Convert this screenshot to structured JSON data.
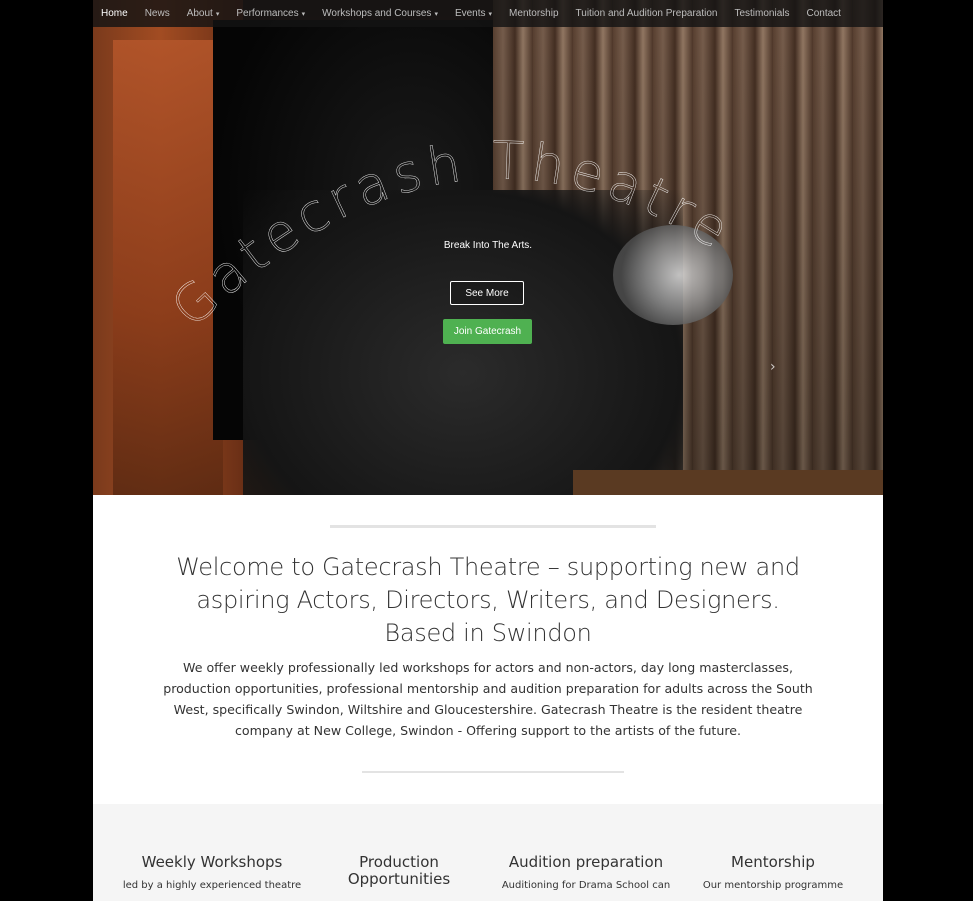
{
  "nav": {
    "items": [
      {
        "label": "Home",
        "active": true,
        "dropdown": false
      },
      {
        "label": "News",
        "active": false,
        "dropdown": false
      },
      {
        "label": "About",
        "active": false,
        "dropdown": true
      },
      {
        "label": "Performances",
        "active": false,
        "dropdown": true
      },
      {
        "label": "Workshops and Courses",
        "active": false,
        "dropdown": true
      },
      {
        "label": "Events",
        "active": false,
        "dropdown": true
      },
      {
        "label": "Mentorship",
        "active": false,
        "dropdown": false
      },
      {
        "label": "Tuition and Audition Preparation",
        "active": false,
        "dropdown": false
      },
      {
        "label": "Testimonials",
        "active": false,
        "dropdown": false
      },
      {
        "label": "Contact",
        "active": false,
        "dropdown": false
      }
    ],
    "caret_glyph": "▾"
  },
  "hero": {
    "title": "Gatecrash Theatre",
    "tagline": "Break Into The Arts.",
    "see_more_label": "See More",
    "join_label": "Join Gatecrash",
    "next_arrow": "›",
    "colors": {
      "join_button": "#4fb151"
    }
  },
  "welcome": {
    "heading_line1": "Welcome to Gatecrash Theatre – supporting new and",
    "heading_line2": "aspiring Actors, Directors, Writers, and Designers.",
    "heading_line3": "Based in Swindon",
    "body_line1": "We offer weekly professionally led workshops for actors and non-actors, day long masterclasses,",
    "body_line2": "production opportunities, professional mentorship and audition preparation for adults across the South",
    "body_line3": "West, specifically Swindon, Wiltshire and Gloucestershire. Gatecrash Theatre is the resident theatre",
    "body_line4": "company at New College, Swindon - Offering support to the artists of the future."
  },
  "features": [
    {
      "title_line1": "Weekly Workshops",
      "title_line2": "",
      "text": "led by a highly experienced theatre"
    },
    {
      "title_line1": "Production",
      "title_line2": "Opportunities",
      "text": ""
    },
    {
      "title_line1": "Audition preparation",
      "title_line2": "",
      "text": "Auditioning for Drama School can"
    },
    {
      "title_line1": "Mentorship",
      "title_line2": "",
      "text": "Our mentorship programme"
    }
  ]
}
